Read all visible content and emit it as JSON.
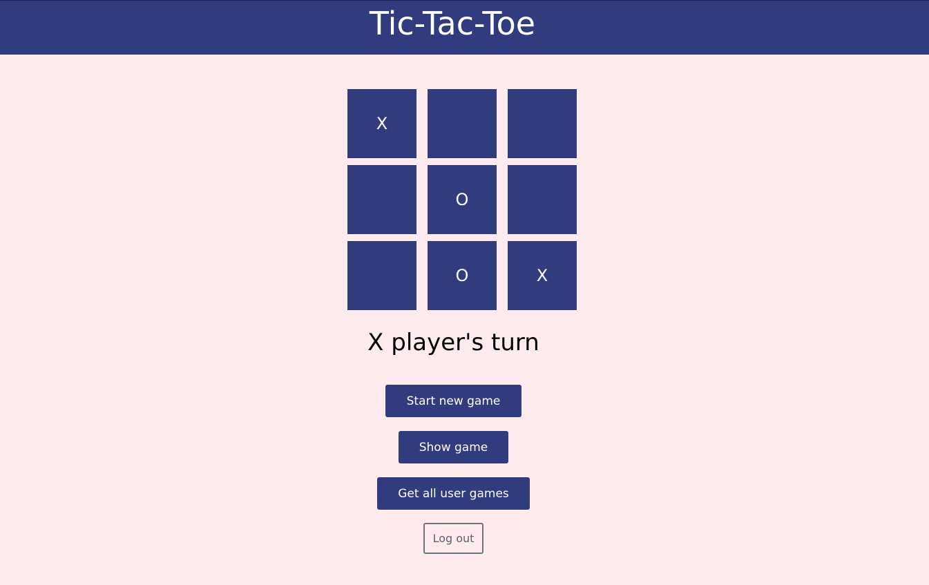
{
  "header": {
    "title": "Tic-Tac-Toe"
  },
  "board": {
    "cells": [
      "X",
      "",
      "",
      "",
      "O",
      "",
      "",
      "O",
      "X"
    ]
  },
  "status": {
    "text": "X player's turn"
  },
  "buttons": {
    "start_new_game": "Start new game",
    "show_game": "Show game",
    "get_all_user_games": "Get all user games",
    "log_out": "Log out"
  },
  "colors": {
    "background": "#ffebee",
    "primary": "#303c7e",
    "text_light": "#ffffff",
    "outline": "#6c757d"
  }
}
